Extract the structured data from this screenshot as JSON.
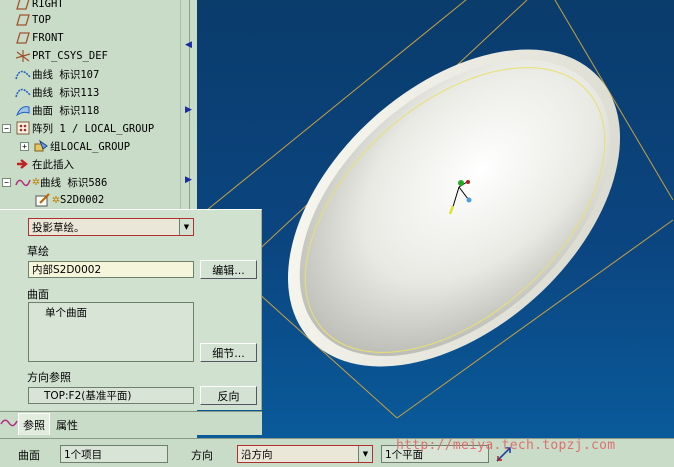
{
  "tree": {
    "items": [
      {
        "label": "RIGHT",
        "icon": "datum-plane-icon"
      },
      {
        "label": "TOP",
        "icon": "datum-plane-icon"
      },
      {
        "label": "FRONT",
        "icon": "datum-plane-icon"
      },
      {
        "label": "PRT_CSYS_DEF",
        "icon": "csys-icon"
      },
      {
        "label": "曲线 标识107",
        "icon": "curve-icon"
      },
      {
        "label": "曲线 标识113",
        "icon": "curve-icon"
      },
      {
        "label": "曲面 标识118",
        "icon": "surface-icon"
      },
      {
        "label": "阵列 1 / LOCAL_GROUP",
        "icon": "pattern-icon"
      },
      {
        "label": "组LOCAL_GROUP",
        "icon": "group-icon"
      },
      {
        "label": "在此插入",
        "icon": "insert-here-arrow-icon"
      },
      {
        "label": "曲线 标识586",
        "icon": "curve-icon"
      },
      {
        "label": "S2D0002",
        "icon": "sketch-icon"
      }
    ]
  },
  "dashboard": {
    "type_select": "投影草绘。",
    "sketch_label": "草绘",
    "sketch_value": "内部S2D0002",
    "edit_button": "编辑...",
    "surface_label": "曲面",
    "surface_item": "单个曲面",
    "details_button": "细节...",
    "direction_ref_label": "方向参照",
    "direction_ref_value": "TOP:F2(基准平面)",
    "flip_button": "反向"
  },
  "tabs": {
    "references": "参照",
    "properties": "属性"
  },
  "bottom": {
    "surface_label": "曲面",
    "surface_value": "1个项目",
    "direction_label": "方向",
    "direction_value": "沿方向",
    "plane_value": "1个平面"
  },
  "watermark": "http://meiya.tech.topzj.com",
  "colors": {
    "panel_bg": "#c9dcc8",
    "viewport_top": "#0a3c6c",
    "viewport_bottom": "#0a5a9a",
    "highlight_border": "#b03030",
    "datum_plane": "#c8a040"
  }
}
